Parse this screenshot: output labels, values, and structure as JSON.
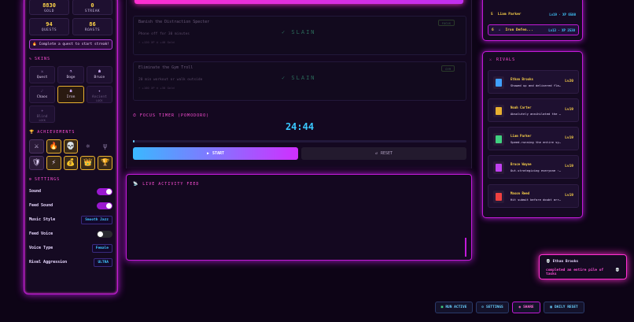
{
  "stats": [
    {
      "value": "8830",
      "label": "GOLD"
    },
    {
      "value": "0",
      "label": "STREAK"
    },
    {
      "value": "94",
      "label": "QUESTS"
    },
    {
      "value": "86",
      "label": "ROASTS"
    }
  ],
  "streak_button": "Complete a quest to start streak!",
  "skins": {
    "title": "SKINS",
    "items": [
      {
        "icon": "⚔",
        "label": "Quest",
        "state": "normal"
      },
      {
        "icon": "⚗",
        "label": "Doge",
        "state": "normal"
      },
      {
        "icon": "☗",
        "label": "Bruce",
        "state": "normal"
      },
      {
        "icon": "☄",
        "label": "Chaos",
        "state": "normal"
      },
      {
        "icon": "☗",
        "label": "Iron",
        "state": "active"
      },
      {
        "icon": "✦",
        "label": "Ancient",
        "state": "locked",
        "sub": "LOCK"
      },
      {
        "icon": "✧",
        "label": "Blind",
        "state": "locked",
        "sub": "LOCK"
      }
    ]
  },
  "achievements": {
    "title": "ACHIEVEMENTS",
    "icons": [
      {
        "glyph": "⚔",
        "state": "normal"
      },
      {
        "glyph": "🔥",
        "state": "gold"
      },
      {
        "glyph": "💀",
        "state": "gold"
      },
      {
        "glyph": "✵",
        "state": "dim"
      },
      {
        "glyph": "ψ",
        "state": "dim"
      },
      {
        "glyph": "🛡",
        "state": "normal"
      },
      {
        "glyph": "⚡",
        "state": "gold"
      },
      {
        "glyph": "💰",
        "state": "gold"
      },
      {
        "glyph": "👑",
        "state": "gold"
      },
      {
        "glyph": "🏆",
        "state": "gold"
      }
    ]
  },
  "settings": {
    "title": "SETTINGS",
    "sound": "Sound",
    "feed_sound": "Feed Sound",
    "music_style": "Music Style",
    "music_value": "Smooth Jazz",
    "feed_voice": "Feed Voice",
    "voice_type": "Voice Type",
    "voice_value": "Female",
    "rival_aggression": "Rival Aggression",
    "aggression_value": "ULTRA"
  },
  "quests": [
    {
      "title": "Banish the Distraction Specter",
      "desc": "Phone off for 30 minutes",
      "reward": "⚡ +120 XP   ◎ +40 Gold",
      "status": "✓ SLAIN",
      "tag": "FOCUS"
    },
    {
      "title": "Eliminate the Gym Troll",
      "desc": "20 min workout or walk outside",
      "reward": "⚡ +100 XP   ◎ +30 Gold",
      "status": "✓ SLAIN",
      "tag": "GYM"
    }
  ],
  "timer": {
    "title": "FOCUS TIMER (POMODORO)",
    "value": "24:44",
    "progress_pct": 0.5,
    "start": "START",
    "reset": "RESET"
  },
  "feed": {
    "title": "LIVE ACTIVITY FEED"
  },
  "leaderboard": [
    {
      "rank": "5",
      "name": "Liam Parker",
      "xp": "Lv19 · XP 6500",
      "me": false
    },
    {
      "rank": "6",
      "name": "Iron Defen...",
      "xp": "Lv13 · XP 2530",
      "me": true
    }
  ],
  "rivals": {
    "title": "RIVALS",
    "items": [
      {
        "name": "Ethan Brooks",
        "msg": "Showed up and delivered fla...",
        "level": "Lv20",
        "color": "#40a0ff"
      },
      {
        "name": "Noah Carter",
        "msg": "Absolutely annihilated the ...",
        "level": "Lv19",
        "color": "#e8b030"
      },
      {
        "name": "Liam Parker",
        "msg": "Speed-running the entire syll...",
        "level": "Lv19",
        "color": "#40d080"
      },
      {
        "name": "Bruce Wayne",
        "msg": "Out-strategizing everyone · ...",
        "level": "Lv19",
        "color": "#c040f0"
      },
      {
        "name": "Mason Reed",
        "msg": "Hit submit before doubt arri...",
        "level": "Lv19",
        "color": "#f04040"
      }
    ]
  },
  "toast": {
    "who": "Ethan Brooks",
    "what": "completed an entire pile of tasks"
  },
  "bottom": {
    "run_active": "RUN ACTIVE",
    "settings": "SETTINGS",
    "share": "SHARE",
    "daily_reset": "DAILY RESET"
  }
}
